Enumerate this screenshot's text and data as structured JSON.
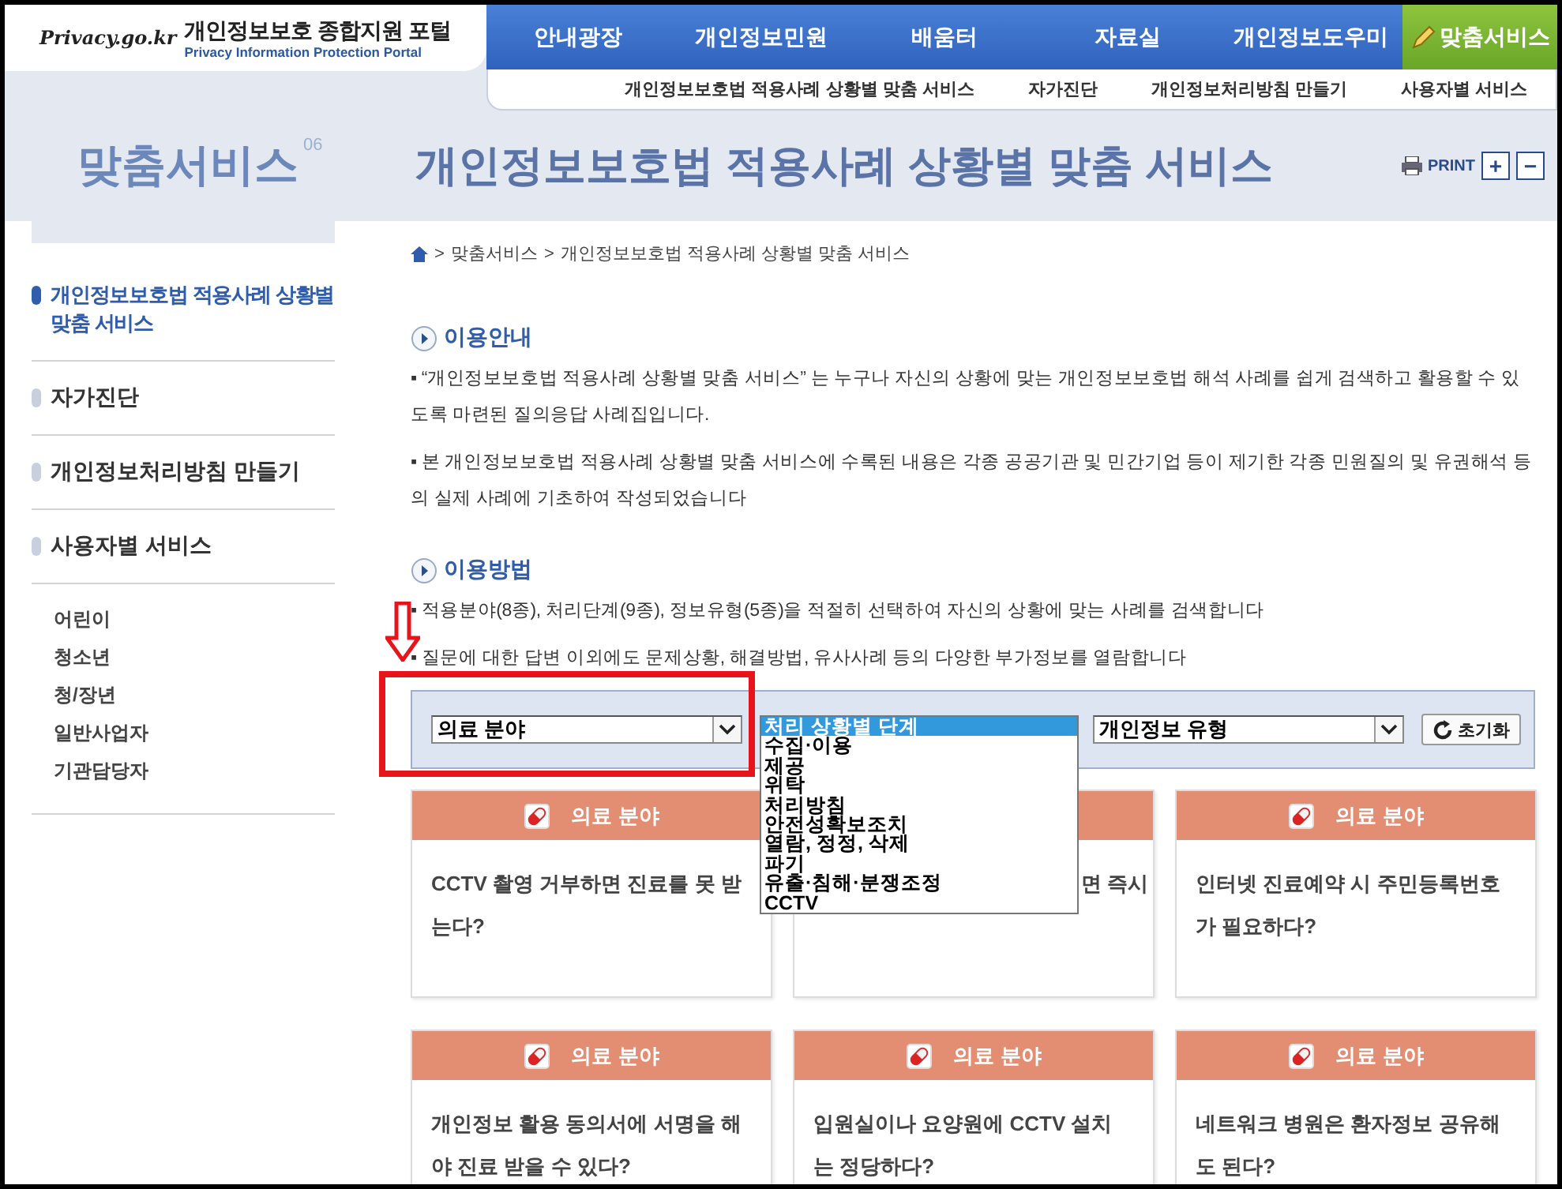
{
  "header": {
    "logo_text": "Privacy.go.kr",
    "portal_title": "개인정보보호 종합지원 포털",
    "portal_subtitle": "Privacy Information Protection Portal",
    "nav": [
      {
        "label": "안내광장",
        "selected": false
      },
      {
        "label": "개인정보민원",
        "selected": false
      },
      {
        "label": "배움터",
        "selected": false
      },
      {
        "label": "자료실",
        "selected": false
      },
      {
        "label": "개인정보도우미",
        "selected": false
      },
      {
        "label": "맞춤서비스",
        "selected": true
      }
    ],
    "subnav": [
      "개인정보보호법 적용사례 상황별 맞춤 서비스",
      "자가진단",
      "개인정보처리방침 만들기",
      "사용자별 서비스"
    ]
  },
  "section": {
    "name": "맞춤서비스",
    "number": "06",
    "title": "개인정보보호법 적용사례 상황별 맞춤 서비스",
    "print": "PRINT",
    "zoom_in": "+",
    "zoom_out": "−"
  },
  "sidebar": {
    "items": [
      {
        "label": "개인정보보호법 적용사례 상황별 맞춤 서비스",
        "selected": true
      },
      {
        "label": "자가진단",
        "selected": false
      },
      {
        "label": "개인정보처리방침 만들기",
        "selected": false
      },
      {
        "label": "사용자별 서비스",
        "selected": false
      }
    ],
    "sub_items": [
      "어린이",
      "청소년",
      "청/장년",
      "일반사업자",
      "기관담당자"
    ]
  },
  "breadcrumb": {
    "separator": ">",
    "items": [
      "맞춤서비스",
      "개인정보보호법 적용사례 상황별 맞춤 서비스"
    ]
  },
  "sections": [
    {
      "heading": "이용안내",
      "paragraphs": [
        "▪ “개인정보보호법 적용사례 상황별 맞춤 서비스” 는 누구나 자신의 상황에 맞는 개인정보보호법 해석 사례를 쉽게 검색하고 활용할 수 있도록 마련된 질의응답 사례집입니다.",
        "▪ 본 개인정보보호법 적용사례 상황별 맞춤 서비스에 수록된 내용은 각종 공공기관 및 민간기업 등이 제기한 각종 민원질의 및 유권해석 등의 실제 사례에 기초하여 작성되었습니다"
      ]
    },
    {
      "heading": "이용방법",
      "paragraphs": [
        "▪ 적용분야(8종), 처리단계(9종), 정보유형(5종)을 적절히 선택하여 자신의 상황에 맞는 사례를 검색합니다",
        "▪ 질문에 대한 답변 이외에도 문제상황, 해결방법, 유사사례 등의 다양한 부가정보를 열람합니다"
      ]
    }
  ],
  "filters": {
    "field_select": {
      "value": "의료 분야"
    },
    "stage_select": {
      "expanded": true,
      "options": [
        {
          "label": "처리 상황별 단계",
          "selected": true
        },
        {
          "label": "수집·이용",
          "selected": false
        },
        {
          "label": "제공",
          "selected": false
        },
        {
          "label": "위탁",
          "selected": false
        },
        {
          "label": "처리방침",
          "selected": false
        },
        {
          "label": "안전성확보조치",
          "selected": false
        },
        {
          "label": "열람, 정정, 삭제",
          "selected": false
        },
        {
          "label": "파기",
          "selected": false
        },
        {
          "label": "유출·침해·분쟁조정",
          "selected": false
        },
        {
          "label": "CCTV",
          "selected": false
        }
      ]
    },
    "type_select": {
      "value": "개인정보 유형"
    },
    "reset_button": "초기화"
  },
  "cards": [
    {
      "kind": "full",
      "category": "의료 분야",
      "question": "CCTV 촬영 거부하면 진료를 못 받는다?"
    },
    {
      "kind": "covered",
      "question": "면 즉시"
    },
    {
      "kind": "full",
      "category": "의료 분야",
      "question": "인터넷 진료예약 시 주민등록번호가 필요하다?"
    },
    {
      "kind": "full",
      "category": "의료 분야",
      "question": "개인정보 활용 동의서에 서명을 해야 진료 받을 수 있다?"
    },
    {
      "kind": "full",
      "category": "의료 분야",
      "question": "입원실이나 요양원에 CCTV 설치는 정당하다?"
    },
    {
      "kind": "full",
      "category": "의료 분야",
      "question": "네트워크 병원은 환자정보 공유해도 된다?"
    }
  ]
}
